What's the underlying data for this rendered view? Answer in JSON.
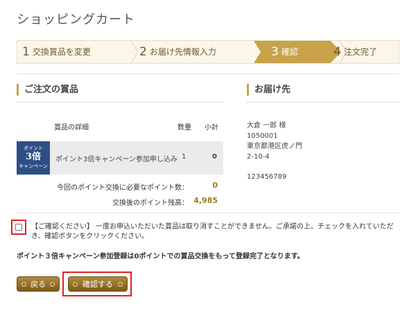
{
  "page": {
    "title": "ショッピングカート"
  },
  "steps": [
    {
      "num": "1",
      "label": "交換賞品を変更"
    },
    {
      "num": "2",
      "label": "お届け先情報入力"
    },
    {
      "num": "3",
      "label": "確認"
    },
    {
      "num": "4",
      "label": "注文完了"
    }
  ],
  "order": {
    "heading": "ご注文の賞品",
    "columns": {
      "detail": "賞品の詳細",
      "qty": "数量",
      "subtotal": "小計"
    },
    "item": {
      "thumb_line1": "ポイント",
      "thumb_line2": "3倍",
      "thumb_line3": "キャンペーン",
      "name": "ポイント3倍キャンペーン参加申し込み",
      "qty": "1",
      "subtotal": "0"
    },
    "needed_label": "今回のポイント交換に必要なポイント数：",
    "needed_value": "0",
    "balance_label": "交換後のポイント残高：",
    "balance_value": "4,985"
  },
  "address": {
    "heading": "お届け先",
    "name": "大倉 一郎 様",
    "postal": "1050001",
    "line1": "東京都港区虎ノ門",
    "line2": "2-10-4",
    "phone": "123456789"
  },
  "confirm": {
    "text": "【ご確認ください】 一度お申込いただいた賞品は取り消すことができません。ご承諾の上、チェックを入れていただき、確認ボタンをクリックください。",
    "checked": false
  },
  "campaign_note": "ポイント３倍キャンペーン参加登録は0ポイントでの賞品交換をもって登録完了となります。",
  "buttons": {
    "back": "戻る",
    "confirm": "確認する"
  },
  "colors": {
    "accent": "#c9a24a",
    "button": "#8a6620",
    "highlight": "#e02020"
  }
}
